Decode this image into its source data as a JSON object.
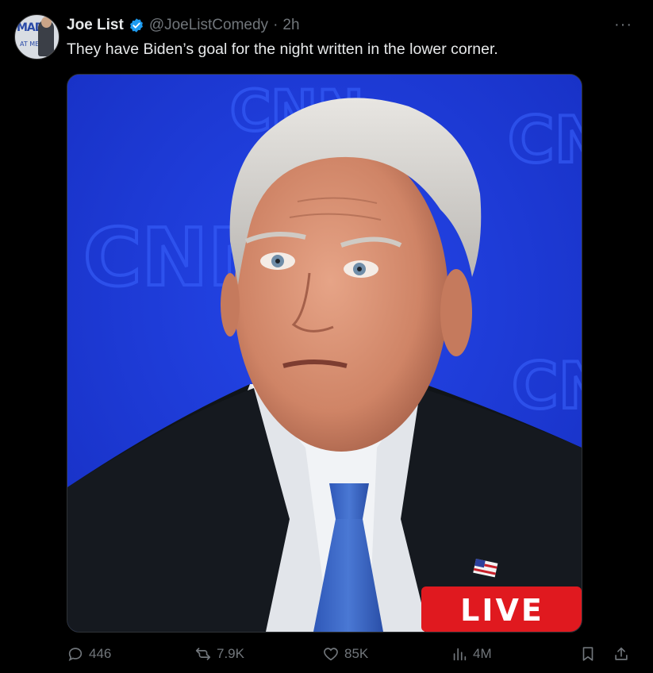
{
  "tweet": {
    "author_name": "Joe List",
    "handle": "@JoeListComedy",
    "separator": "·",
    "time": "2h",
    "text": "They have Biden’s goal for the night written in the lower corner.",
    "more_label": "···"
  },
  "avatar": {
    "line1": "MAD",
    "line2": "AT ME?"
  },
  "media": {
    "alt": "Joe Biden on CNN debate stage with LIVE banner",
    "watermark": "CNN",
    "live_label": "LIVE"
  },
  "actions": {
    "replies": "446",
    "reposts": "7.9K",
    "likes": "85K",
    "views": "4M"
  },
  "colors": {
    "background": "#000000",
    "text": "#e7e9ea",
    "secondary": "#71767b",
    "verified": "#1d9bf0",
    "cnn_blue": "#1f3bdc",
    "live_red": "#e0191f"
  }
}
